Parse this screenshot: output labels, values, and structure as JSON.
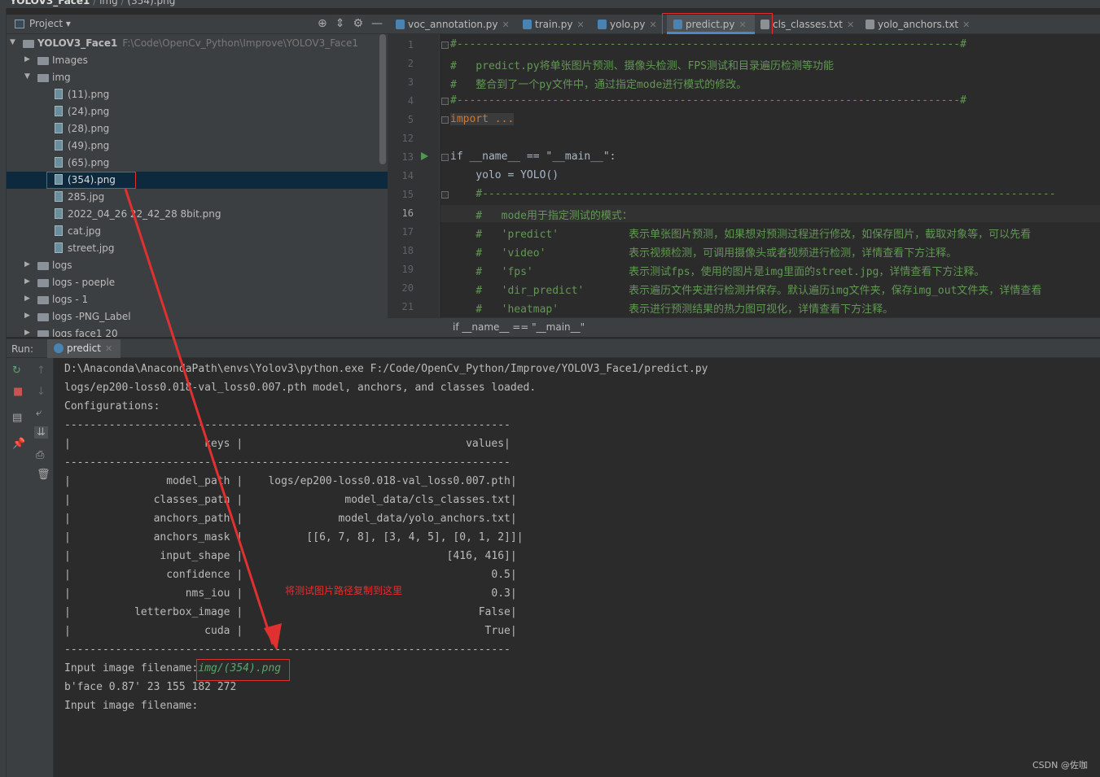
{
  "breadcrumb": [
    "YOLOV3_Face1",
    "img",
    "(354).png"
  ],
  "project_panel": {
    "title": "Project",
    "tools": [
      "crosshair-icon",
      "collapse-icon",
      "gear-icon",
      "minimize-icon"
    ],
    "tree": [
      {
        "label": "YOLOV3_Face1",
        "path": "F:\\Code\\OpenCv_Python\\Improve\\YOLOV3_Face1",
        "type": "root"
      },
      {
        "label": "Images",
        "type": "folder"
      },
      {
        "label": "img",
        "type": "folder-open"
      },
      {
        "label": "(11).png",
        "type": "file"
      },
      {
        "label": "(24).png",
        "type": "file"
      },
      {
        "label": "(28).png",
        "type": "file"
      },
      {
        "label": "(49).png",
        "type": "file"
      },
      {
        "label": "(65).png",
        "type": "file"
      },
      {
        "label": "(354).png",
        "type": "file",
        "selected": true
      },
      {
        "label": "285.jpg",
        "type": "file"
      },
      {
        "label": "2022_04_26 22_42_28 8bit.png",
        "type": "file"
      },
      {
        "label": "cat.jpg",
        "type": "file"
      },
      {
        "label": "street.jpg",
        "type": "file"
      },
      {
        "label": "logs",
        "type": "folder"
      },
      {
        "label": "logs - poeple",
        "type": "folder"
      },
      {
        "label": "logs - 1",
        "type": "folder"
      },
      {
        "label": "logs -PNG_Label",
        "type": "folder"
      },
      {
        "label": "logs face1 20",
        "type": "folder"
      }
    ]
  },
  "tabs": [
    {
      "label": "voc_annotation.py"
    },
    {
      "label": "train.py"
    },
    {
      "label": "yolo.py"
    },
    {
      "label": "predict.py",
      "active": true
    },
    {
      "label": "cls_classes.txt"
    },
    {
      "label": "yolo_anchors.txt"
    }
  ],
  "editor": {
    "line_numbers": [
      "1",
      "2",
      "3",
      "4",
      "5",
      "12",
      "13",
      "14",
      "15",
      "16",
      "17",
      "18",
      "19",
      "20",
      "21"
    ],
    "current_line": "16",
    "lines": [
      "#-------------------------------------------------------------------------------#",
      "#   predict.py将单张图片预测、摄像头检测、FPS测试和目录遍历检测等功能",
      "#   整合到了一个py文件中，通过指定mode进行模式的修改。",
      "#-------------------------------------------------------------------------------#",
      "import ...",
      "",
      "if __name__ == \"__main__\":",
      "    yolo = YOLO()",
      "    #------------------------------------------------------------------------------------------",
      "    #   mode用于指定测试的模式：",
      "    #   'predict'           表示单张图片预测，如果想对预测过程进行修改，如保存图片，截取对象等，可以先看",
      "    #   'video'             表示视频检测，可调用摄像头或者视频进行检测，详情查看下方注释。",
      "    #   'fps'               表示测试fps，使用的图片是img里面的street.jpg，详情查看下方注释。",
      "    #   'dir_predict'       表示遍历文件夹进行检测并保存。默认遍历img文件夹，保存img_out文件夹，详情查看",
      "    #   'heatmap'           表示进行预测结果的热力图可视化，详情查看下方注释。"
    ],
    "status_crumb": "if __name__ == \"__main__\""
  },
  "run_panel": {
    "label": "Run:",
    "tab": "predict",
    "console": [
      "D:\\Anaconda\\AnacondaPath\\envs\\Yolov3\\python.exe F:/Code/OpenCv_Python/Improve/YOLOV3_Face1/predict.py",
      "logs/ep200-loss0.018-val_loss0.007.pth model, anchors, and classes loaded.",
      "Configurations:",
      "----------------------------------------------------------------------",
      "|                     keys |                                   values|",
      "----------------------------------------------------------------------",
      "|               model_path |    logs/ep200-loss0.018-val_loss0.007.pth|",
      "|             classes_path |                model_data/cls_classes.txt|",
      "|             anchors_path |               model_data/yolo_anchors.txt|",
      "|             anchors_mask |          [[6, 7, 8], [3, 4, 5], [0, 1, 2]]|",
      "|              input_shape |                                [416, 416]|",
      "|               confidence |                                       0.5|",
      "|                  nms_iou |                                       0.3|",
      "|          letterbox_image |                                     False|",
      "|                     cuda |                                      True|",
      "----------------------------------------------------------------------",
      "Input image filename:",
      "b'face 0.87' 23 155 182 272",
      "Input image filename:"
    ],
    "user_input": "img/(354).png"
  },
  "annotation": "将测试图片路径复制到这里",
  "watermark": "CSDN @佐咖",
  "colors": {
    "highlight": "#e03030",
    "comment": "#629755",
    "keyword": "#cc7832",
    "string": "#6a8759",
    "selection": "#0d293e"
  }
}
